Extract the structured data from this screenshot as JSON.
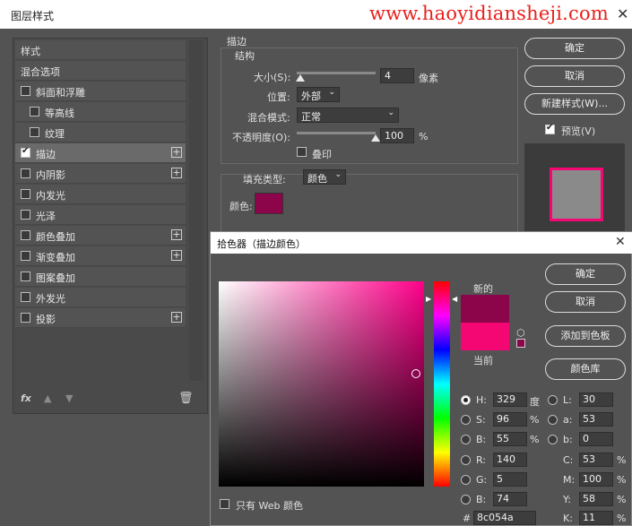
{
  "window": {
    "title": "图层样式",
    "watermark": "www.haoyidiansheji.com"
  },
  "styles_list": {
    "header": "样式",
    "items": [
      {
        "label": "混合选项",
        "checkbox": false,
        "checked": false,
        "plus": false,
        "indent": false
      },
      {
        "label": "斜面和浮雕",
        "checkbox": true,
        "checked": false,
        "plus": false,
        "indent": false
      },
      {
        "label": "等高线",
        "checkbox": true,
        "checked": false,
        "plus": false,
        "indent": true
      },
      {
        "label": "纹理",
        "checkbox": true,
        "checked": false,
        "plus": false,
        "indent": true
      },
      {
        "label": "描边",
        "checkbox": true,
        "checked": true,
        "plus": true,
        "indent": false
      },
      {
        "label": "内阴影",
        "checkbox": true,
        "checked": false,
        "plus": true,
        "indent": false
      },
      {
        "label": "内发光",
        "checkbox": true,
        "checked": false,
        "plus": false,
        "indent": false
      },
      {
        "label": "光泽",
        "checkbox": true,
        "checked": false,
        "plus": false,
        "indent": false
      },
      {
        "label": "颜色叠加",
        "checkbox": true,
        "checked": false,
        "plus": true,
        "indent": false
      },
      {
        "label": "渐变叠加",
        "checkbox": true,
        "checked": false,
        "plus": true,
        "indent": false
      },
      {
        "label": "图案叠加",
        "checkbox": true,
        "checked": false,
        "plus": false,
        "indent": false
      },
      {
        "label": "外发光",
        "checkbox": true,
        "checked": false,
        "plus": false,
        "indent": false
      },
      {
        "label": "投影",
        "checkbox": true,
        "checked": false,
        "plus": true,
        "indent": false
      }
    ],
    "bottom_fx": "fx"
  },
  "stroke": {
    "title": "描边",
    "structure_title": "结构",
    "size_label": "大小(S):",
    "size_value": "4",
    "size_unit": "像素",
    "size_level": 0.05,
    "position_label": "位置:",
    "position_value": "外部",
    "blend_label": "混合模式:",
    "blend_value": "正常",
    "opacity_label": "不透明度(O):",
    "opacity_value": "100",
    "opacity_unit": "%",
    "opacity_level": 1.0,
    "emboss_label": "叠印",
    "fill_type_label": "填充类型:",
    "fill_type_value": "颜色",
    "color_label": "颜色:",
    "color_hex": "#8c054a"
  },
  "dialog_buttons": {
    "ok": "确定",
    "cancel": "取消",
    "new_style": "新建样式(W)...",
    "preview": "预览(V)"
  },
  "picker": {
    "title": "拾色器（描边颜色）",
    "new_label": "新的",
    "current_label": "当前",
    "new_color": "#8c054a",
    "current_color": "#f40673",
    "ok": "确定",
    "cancel": "取消",
    "add_swatch": "添加到色板",
    "color_lib": "颜色库",
    "web_only": "只有 Web 颜色",
    "hsb": {
      "H": "329",
      "H_unit": "度",
      "S": "96",
      "S_unit": "%",
      "B": "55",
      "B_unit": "%"
    },
    "rgb": {
      "R": "140",
      "G": "5",
      "B": "74"
    },
    "lab": {
      "L": "30",
      "a": "53",
      "b": "0"
    },
    "cmyk": {
      "C": "53",
      "M": "100",
      "Y": "58",
      "K": "11",
      "unit": "%"
    },
    "hex": "8c054a",
    "hue_base": "#ff008a"
  }
}
